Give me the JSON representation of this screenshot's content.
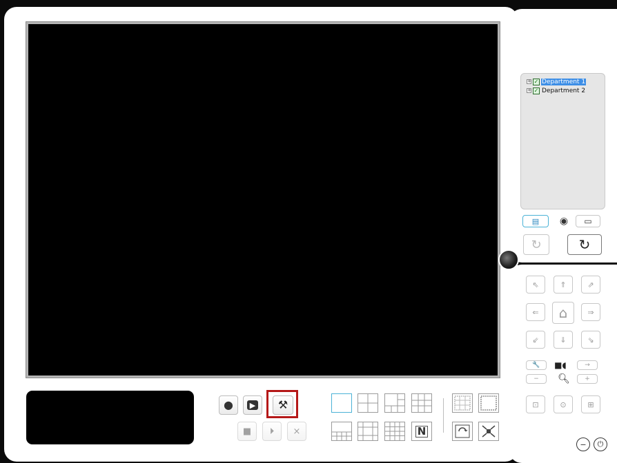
{
  "device_tree": {
    "items": [
      {
        "label": "Department 1",
        "checked": true,
        "selected": true,
        "expander": "+"
      },
      {
        "label": "Department 2",
        "checked": true,
        "selected": false,
        "expander": "+"
      }
    ]
  },
  "tabs": [
    {
      "icon": "device-list-icon",
      "active": true
    },
    {
      "icon": "eye-icon",
      "active": false
    },
    {
      "icon": "monitor-icon",
      "active": false
    }
  ],
  "refresh_buttons": [
    {
      "icon": "refresh-dim-icon"
    },
    {
      "icon": "refresh-icon"
    }
  ],
  "ptz": {
    "directions": [
      "up-left",
      "up",
      "up-right",
      "left",
      "home",
      "right",
      "down-left",
      "down",
      "down-right"
    ],
    "glyphs": {
      "up-left": "⇖",
      "up": "⇑",
      "up-right": "⇗",
      "left": "⇐",
      "home": "⌂",
      "right": "⇒",
      "down-left": "⇙",
      "down": "⇓",
      "down-right": "⇘"
    },
    "zoom_minus": "−",
    "zoom_plus": "+",
    "arrow_right": "→",
    "presets": [
      "⊡",
      "⊙",
      "⊞"
    ]
  },
  "playback_controls": {
    "record": "●",
    "play": "▶",
    "tools": "⚒",
    "stop": "■",
    "step": "⏵",
    "close": "×"
  },
  "layouts": {
    "n_label": "N"
  },
  "footer": {
    "minimize": "−",
    "power": "⏻"
  },
  "colors": {
    "accent": "#4ab2d6",
    "highlight": "#b51818",
    "selection": "#3d8ee6"
  }
}
